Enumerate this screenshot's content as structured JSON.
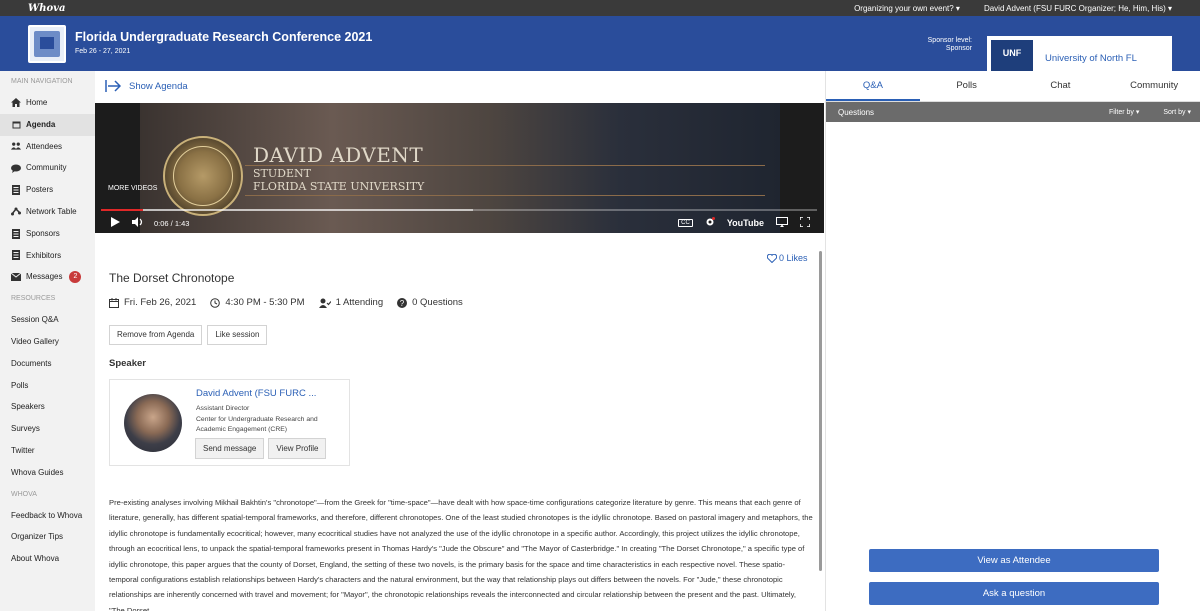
{
  "topbar": {
    "logo": "Whova",
    "organizing": "Organizing your own event? ▾",
    "user": "David Advent (FSU FURC Organizer; He, Him, His) ▾"
  },
  "event": {
    "title": "Florida Undergraduate Research Conference 2021",
    "dates": "Feb 26 - 27, 2021",
    "sponsor_label_line1": "Sponsor level:",
    "sponsor_label_line2": "Sponsor",
    "sponsor_logo_text": "UNF",
    "sponsor_name": "University of North FL"
  },
  "sidebar": {
    "main_nav_label": "MAIN NAVIGATION",
    "main_items": [
      {
        "label": "Home",
        "icon": "home-icon"
      },
      {
        "label": "Agenda",
        "icon": "calendar-icon",
        "active": true
      },
      {
        "label": "Attendees",
        "icon": "people-icon"
      },
      {
        "label": "Community",
        "icon": "chat-icon"
      },
      {
        "label": "Posters",
        "icon": "document-icon"
      },
      {
        "label": "Network Table",
        "icon": "network-icon"
      },
      {
        "label": "Sponsors",
        "icon": "document-icon"
      },
      {
        "label": "Exhibitors",
        "icon": "document-icon"
      },
      {
        "label": "Messages",
        "icon": "message-icon",
        "badge": "2"
      }
    ],
    "resources_label": "RESOURCES",
    "resource_items": [
      "Session Q&A",
      "Video Gallery",
      "Documents",
      "Polls",
      "Speakers",
      "Surveys",
      "Twitter",
      "Whova Guides"
    ],
    "whova_label": "WHOVA",
    "whova_items": [
      "Feedback to Whova",
      "Organizer Tips",
      "About Whova"
    ]
  },
  "main": {
    "show_agenda": "Show Agenda",
    "video": {
      "name": "DAVID ADVENT",
      "role": "STUDENT",
      "school": "FLORIDA STATE UNIVERSITY",
      "more_videos": "MORE VIDEOS",
      "time": "0:06 / 1:43",
      "progress": 0.058,
      "buffered": 0.52,
      "cc": "CC",
      "youtube": "YouTube"
    },
    "likes": "0 Likes",
    "session_title": "The Dorset Chronotope",
    "date": "Fri. Feb 26, 2021",
    "time": "4:30 PM - 5:30 PM",
    "attending": "1 Attending",
    "questions": "0 Questions",
    "remove_btn": "Remove from Agenda",
    "like_btn": "Like session",
    "speaker_header": "Speaker",
    "speaker": {
      "name": "David Advent (FSU FURC ...",
      "title": "Assistant Director",
      "org": "Center for Undergraduate Research and Academic Engagement (CRE)",
      "send_message": "Send message",
      "view_profile": "View Profile"
    },
    "description": "Pre-existing analyses involving Mikhail Bakhtin's \"chronotope\"—from the Greek for \"time-space\"—have dealt with how space-time configurations categorize literature by genre. This means that each genre of literature, generally, has different spatial-temporal frameworks, and therefore, different chronotopes. One of the least studied chronotopes is the idyllic chronotope. Based on pastoral imagery and metaphors, the idyllic chronotope is fundamentally ecocritical; however, many ecocritical studies have not analyzed the use of the idyllic chronotope in a specific author. Accordingly, this project utilizes the idyllic chronotope, through an ecocritical lens, to unpack the spatial-temporal frameworks present in Thomas Hardy's \"Jude the Obscure\" and \"The Mayor of Casterbridge.\" In creating \"The Dorset Chronotope,\" a specific type of idyllic chronotope, this paper argues that the county of Dorset, England, the setting of these two novels, is the primary basis for the space and time characteristics in each respective novel. These spatio-temporal configurations establish relationships between Hardy's characters and the natural environment, but the way that relationship plays out differs between the novels. For \"Jude,\" these chronotopic relationships are inherently concerned with travel and movement; for \"Mayor\", the chronotopic relationships reveals the interconnected and circular relationship between the present and the past. Ultimately, \"The Dorset"
  },
  "right": {
    "tabs": [
      "Q&A",
      "Polls",
      "Chat",
      "Community"
    ],
    "questions_label": "Questions",
    "filter_by": "Filter by ▾",
    "sort_by": "Sort by ▾",
    "view_as_attendee": "View as Attendee",
    "ask_question": "Ask a question"
  },
  "colors": {
    "header_blue": "#2a4d9b",
    "link_blue": "#2a5fb5",
    "button_blue": "#3d6cc1",
    "badge_red": "#c83b3b",
    "progress_red": "#e02828"
  }
}
